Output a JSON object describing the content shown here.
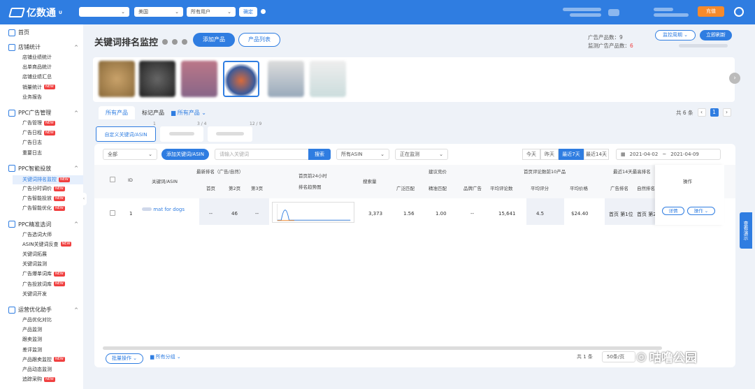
{
  "app": {
    "logo": "亿数通",
    "logo_sup": "U"
  },
  "header": {
    "select1": "",
    "select2": "美国",
    "select3": "所有用户",
    "confirm": "确定",
    "vip": "充值"
  },
  "sidebar": {
    "home": "首页",
    "sections": [
      {
        "label": "店铺统计",
        "items": [
          {
            "label": "店铺业绩统计"
          },
          {
            "label": "出单商品统计"
          },
          {
            "label": "店铺业绩汇总"
          },
          {
            "label": "销量统计",
            "badge": "NEW"
          },
          {
            "label": "业务报告"
          }
        ]
      },
      {
        "label": "PPC广告管理",
        "items": [
          {
            "label": "广告管理",
            "badge": "NEW"
          },
          {
            "label": "广告日程",
            "badge": "NEW"
          },
          {
            "label": "广告日志"
          },
          {
            "label": "重要日志"
          }
        ]
      },
      {
        "label": "PPC智能投放",
        "items": [
          {
            "label": "关键词排名监控",
            "badge": "NEW",
            "active": true
          },
          {
            "label": "广告分时调价",
            "badge": "NEW"
          },
          {
            "label": "广告智能投放",
            "badge": "NEW"
          },
          {
            "label": "广告智能优化",
            "badge": "NEW"
          }
        ]
      },
      {
        "label": "PPC精准选词",
        "items": [
          {
            "label": "广告选词大师"
          },
          {
            "label": "ASIN关键词反查",
            "badge": "NEW"
          },
          {
            "label": "关键词拓展"
          },
          {
            "label": "关键词监测"
          },
          {
            "label": "广告爆单词库",
            "badge": "NEW"
          },
          {
            "label": "广告投放词库",
            "badge": "NEW"
          },
          {
            "label": "关键词开发"
          }
        ]
      },
      {
        "label": "运营优化助手",
        "items": [
          {
            "label": "产品优化对比"
          },
          {
            "label": "产品监测"
          },
          {
            "label": "跟卖监测"
          },
          {
            "label": "差评监测"
          },
          {
            "label": "产品跟卖监控",
            "badge": "NEW"
          },
          {
            "label": "产品动态监测"
          },
          {
            "label": "追踪采购",
            "badge": "NEW"
          }
        ]
      }
    ]
  },
  "main": {
    "title": "关键词排名监控",
    "add_product": "添加产品",
    "product_list": "产品列表",
    "stat1_label": "广告产品数：",
    "stat1_value": "9",
    "stat2_label": "监测广告产品数：",
    "stat2_value": "6",
    "monitor_btn": "监控周期",
    "refresh_btn": "立即刷新",
    "tabs": [
      "所有产品",
      "标记产品",
      "所有产品"
    ],
    "pager_total": "共 6 条",
    "pager_current": "1",
    "subtabs": [
      {
        "label": "自定义关键词/ASIN",
        "count": "1"
      },
      {
        "label": "",
        "count": "3 / 4"
      },
      {
        "label": "",
        "count": "12 / 9"
      }
    ],
    "filter": {
      "all": "全部",
      "add_kw": "添加关键词/ASIN",
      "search_ph": "请输入关键词",
      "search": "搜索",
      "asin": "所有ASIN",
      "status": "正在监测",
      "today": "今天",
      "yesterday": "昨天",
      "last7": "最近7天",
      "last14": "最近14天",
      "date_from": "2021-04-02",
      "date_sep": "~",
      "date_to": "2021-04-09"
    },
    "table": {
      "headers": {
        "id": "ID",
        "kw": "关键词/ASIN",
        "natural": "最新排名（广告/自然）",
        "trend_top": "首页前24小时",
        "trend": "排名趋势图",
        "search": "搜索量",
        "bid": "建议竞价",
        "broad": "广泛匹配",
        "exact": "精准匹配",
        "brand": "品牌广告",
        "top10": "首页评论数前10产品",
        "avg_reviews": "平均评论数",
        "avg_rating": "平均评分",
        "avg_price": "平均价格",
        "recent14": "最近14天最高排名",
        "ad_rank": "广告排名",
        "nat_rank": "自然排名",
        "op": "操作",
        "page1": "首页",
        "page2": "第2页",
        "page3": "第3页"
      },
      "rows": [
        {
          "id": "1",
          "kw": "mat for dogs",
          "p1": "--",
          "p2": "46",
          "p3": "--",
          "search": "3,373",
          "broad": "1.56",
          "exact": "1.00",
          "brand": "--",
          "avg_reviews": "15,641",
          "avg_rating": "4.5",
          "avg_price": "$24.40",
          "ad_rank": "首页 第1位",
          "nat_rank": "首页 第2",
          "detail": "详情",
          "ops": "操作"
        }
      ]
    },
    "footer": {
      "batch": "批量操作",
      "group": "所有分组",
      "total": "共 1 条",
      "per_page": "50条/页"
    },
    "float_btn": "查看演示"
  },
  "watermark": "咕噜公园"
}
